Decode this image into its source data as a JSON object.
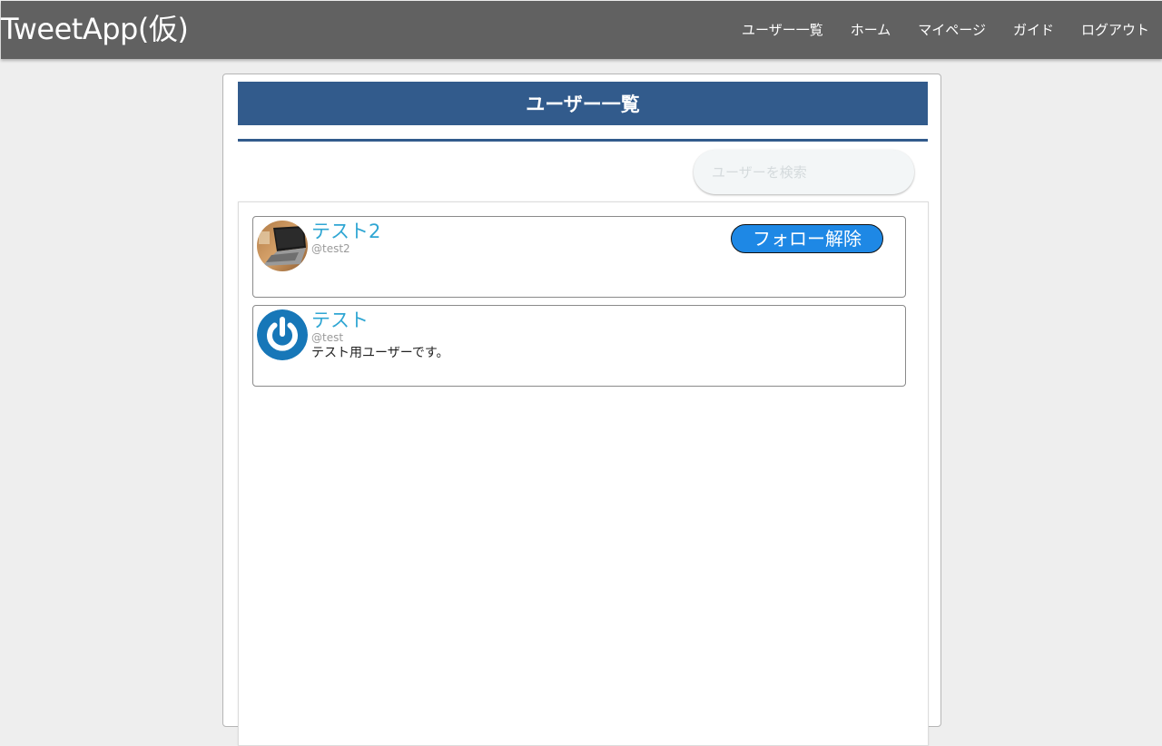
{
  "header": {
    "brand": "TweetApp(仮)",
    "nav": [
      "ユーザー一覧",
      "ホーム",
      "マイページ",
      "ガイド",
      "ログアウト"
    ]
  },
  "page": {
    "title": "ユーザー一覧"
  },
  "search": {
    "placeholder": "ユーザーを検索"
  },
  "users": [
    {
      "name": "テスト2",
      "handle": "@test2",
      "bio": "",
      "avatar_icon": "laptop-photo-icon",
      "follow_label": "フォロー解除"
    },
    {
      "name": "テスト",
      "handle": "@test",
      "bio": "テスト用ユーザーです。",
      "avatar_icon": "power-icon"
    }
  ],
  "colors": {
    "header_bg": "#616161",
    "title_bar": "#325b8c",
    "user_name": "#2fa6d3",
    "follow_button": "#1e88e5"
  }
}
